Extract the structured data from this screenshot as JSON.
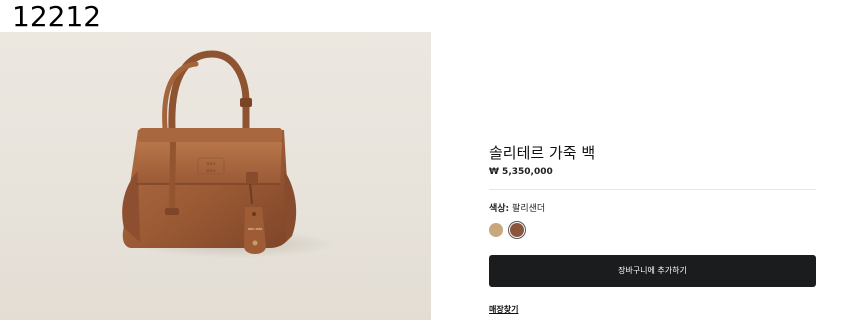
{
  "page_label": "12212",
  "product": {
    "title": "솔리테르 가죽 백",
    "price": "₩ 5,350,000",
    "image_alt": "brown-leather-handbag-photo",
    "color_label": "색상:",
    "color_value": "팔리샌더",
    "swatches": [
      {
        "name": "beige",
        "color": "#c9a77d",
        "selected": false
      },
      {
        "name": "palissandre",
        "color": "#8a553a",
        "selected": true
      }
    ]
  },
  "actions": {
    "add_to_cart": "장바구니에 추가하기",
    "find_store": "매장찾기"
  },
  "colors": {
    "button_bg": "#1b1c1e",
    "bag_leather": "#a0603a"
  }
}
